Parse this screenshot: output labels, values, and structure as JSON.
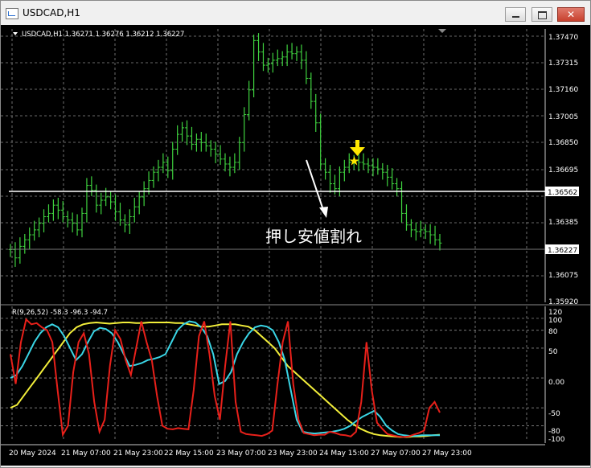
{
  "window": {
    "title": "USDCAD,H1",
    "minimize_label": "minimize",
    "maximize_label": "maximize",
    "close_label": "close"
  },
  "colors": {
    "background": "#000000",
    "grid": "#8a8a8a",
    "candle": "#3fd23f",
    "hline": "#ffffff",
    "red": "#e8201a",
    "cyan": "#3ad6e6",
    "yellow": "#f2ee3a",
    "arrow": "#ffe800"
  },
  "price_chart": {
    "header": "USDCAD,H1  1.36271 1.36276 1.36212 1.36227",
    "y_ticks": [
      "1.37470",
      "1.37315",
      "1.37160",
      "1.37005",
      "1.36850",
      "1.36695",
      "1.36385",
      "1.36075",
      "1.35920"
    ],
    "hline_label": "1.36562",
    "current_label": "1.36227",
    "annotation": "押し安値割れ"
  },
  "indicator": {
    "header": "R(9,26,52) -58.3 -96.3 -94.7",
    "y_ticks": [
      "120",
      "100",
      "80",
      "50",
      "0.00",
      "-50",
      "-80",
      "-100"
    ]
  },
  "x_ticks": [
    "20 May 2024",
    "21 May 07:00",
    "21 May 23:00",
    "22 May 15:00",
    "23 May 07:00",
    "23 May 23:00",
    "24 May 15:00",
    "27 May 07:00",
    "27 May 23:00"
  ],
  "chart_data": [
    {
      "type": "candlestick",
      "title": "USDCAD,H1",
      "ylim": [
        1.3586,
        1.3752
      ],
      "grid": true,
      "hlines": [
        1.36562,
        1.36227
      ],
      "annotations": [
        "押し安値割れ"
      ],
      "x_labels": [
        "20 May 2024",
        "21 May 07:00",
        "21 May 23:00",
        "22 May 15:00",
        "23 May 07:00",
        "23 May 23:00",
        "24 May 15:00",
        "27 May 07:00",
        "27 May 23:00"
      ],
      "close": [
        1.3618,
        1.3613,
        1.362,
        1.3624,
        1.3627,
        1.363,
        1.3634,
        1.3638,
        1.364,
        1.3645,
        1.3642,
        1.3638,
        1.3636,
        1.3634,
        1.363,
        1.364,
        1.3657,
        1.3654,
        1.3645,
        1.3648,
        1.365,
        1.3647,
        1.3641,
        1.3636,
        1.3633,
        1.3638,
        1.3644,
        1.365,
        1.3655,
        1.366,
        1.3665,
        1.3668,
        1.3671,
        1.3666,
        1.3679,
        1.3688,
        1.3692,
        1.3687,
        1.3682,
        1.3685,
        1.3683,
        1.3681,
        1.3679,
        1.3676,
        1.3673,
        1.367,
        1.3668,
        1.3671,
        1.3683,
        1.37,
        1.3715,
        1.3745,
        1.3738,
        1.373,
        1.3731,
        1.3733,
        1.3734,
        1.3735,
        1.3738,
        1.3737,
        1.3738,
        1.3733,
        1.3722,
        1.3708,
        1.3695,
        1.367,
        1.3665,
        1.3658,
        1.3655,
        1.3665,
        1.3668,
        1.3671,
        1.3672,
        1.3671,
        1.367,
        1.3669,
        1.3668,
        1.3667,
        1.3665,
        1.3662,
        1.3658,
        1.3655,
        1.364,
        1.3633,
        1.363,
        1.3629,
        1.363,
        1.3629,
        1.3627,
        1.3624,
        1.3622
      ]
    },
    {
      "type": "line",
      "title": "R(9,26,52) -58.3 -96.3 -94.7",
      "ylim": [
        -105,
        120
      ],
      "grid": true,
      "y_ticks": [
        120,
        100,
        80,
        50,
        0,
        -50,
        -80,
        -100
      ],
      "series": [
        {
          "name": "9",
          "color": "#e8201a",
          "values": [
            40,
            -10,
            60,
            98,
            90,
            92,
            85,
            80,
            60,
            -20,
            -95,
            -80,
            10,
            60,
            75,
            40,
            -40,
            -90,
            -70,
            20,
            80,
            65,
            30,
            5,
            50,
            95,
            60,
            30,
            -30,
            -80,
            -85,
            -86,
            -84,
            -85,
            -86,
            -20,
            70,
            95,
            40,
            -30,
            -70,
            20,
            95,
            -40,
            -90,
            -94,
            -95,
            -96,
            -97,
            -94,
            -88,
            -10,
            60,
            95,
            -10,
            -70,
            -92,
            -94,
            -96,
            -95,
            -95,
            -90,
            -92,
            -95,
            -96,
            -98,
            -90,
            -40,
            60,
            -20,
            -75,
            -85,
            -94,
            -96,
            -98,
            -99,
            -98,
            -95,
            -92,
            -88,
            -50,
            -40,
            -58
          ]
        },
        {
          "name": "26",
          "color": "#3ad6e6",
          "values": [
            0,
            5,
            20,
            40,
            60,
            75,
            85,
            90,
            85,
            70,
            50,
            30,
            40,
            60,
            78,
            84,
            82,
            75,
            60,
            40,
            20,
            22,
            25,
            30,
            32,
            35,
            40,
            60,
            80,
            90,
            95,
            93,
            85,
            70,
            40,
            -10,
            -5,
            10,
            40,
            60,
            75,
            85,
            88,
            86,
            80,
            60,
            30,
            -20,
            -70,
            -90,
            -92,
            -93,
            -92,
            -91,
            -90,
            -88,
            -85,
            -80,
            -72,
            -65,
            -60,
            -55,
            -65,
            -80,
            -88,
            -94,
            -96,
            -97,
            -97,
            -96,
            -96,
            -96,
            -96
          ]
        },
        {
          "name": "52",
          "color": "#f2ee3a",
          "values": [
            -50,
            -45,
            -30,
            -15,
            0,
            15,
            30,
            45,
            60,
            75,
            85,
            90,
            92,
            93,
            92,
            91,
            92,
            93,
            93,
            92,
            92,
            93,
            93,
            93,
            93,
            92,
            92,
            90,
            88,
            86,
            86,
            88,
            90,
            90,
            90,
            88,
            86,
            80,
            70,
            60,
            50,
            35,
            20,
            10,
            0,
            -10,
            -20,
            -30,
            -40,
            -50,
            -60,
            -70,
            -78,
            -85,
            -90,
            -94,
            -96,
            -97,
            -98,
            -99,
            -99,
            -98,
            -98,
            -97,
            -96,
            -95
          ]
        }
      ]
    }
  ]
}
